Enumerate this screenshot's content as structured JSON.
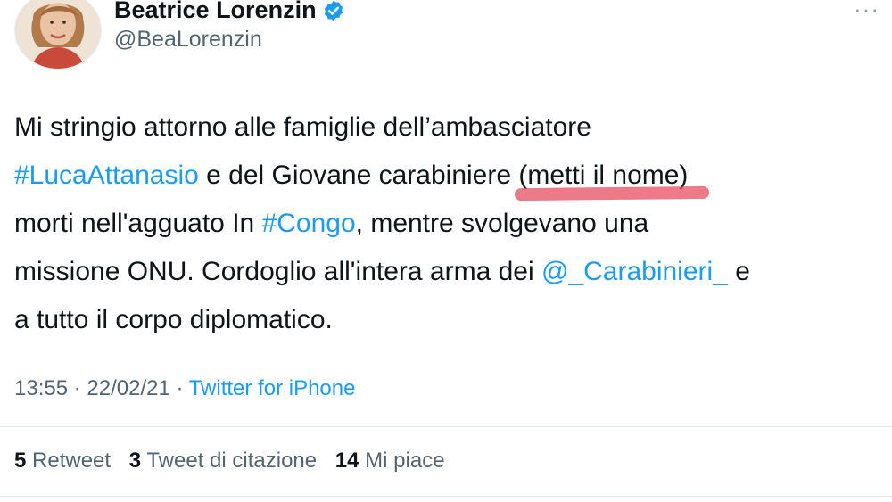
{
  "author": {
    "display_name": "Beatrice Lorenzin",
    "handle": "@BeaLorenzin",
    "verified": true
  },
  "more_menu": "···",
  "tweet": {
    "line1": "Mi stringio attorno alle famiglie dell’ambasciatore",
    "hashtag_luca": "#LucaAttanasio",
    "line2_mid": " e del Giovane carabiniere ",
    "placeholder_text": "(metti il nome)",
    "line3_start": "morti nell'agguato In ",
    "hashtag_congo": "#Congo",
    "line3_end": ", mentre svolgevano una",
    "line4_start": "missione ONU. Cordoglio all'intera arma dei ",
    "mention_carabinieri": "@_Carabinieri_",
    "line4_end": " e",
    "line5": "a tutto il corpo diplomatico."
  },
  "meta": {
    "time": "13:55",
    "sep1": " · ",
    "date": "22/02/21",
    "sep2": " · ",
    "source": "Twitter for iPhone"
  },
  "stats": {
    "retweets_count": "5",
    "retweets_label": "Retweet",
    "quotes_count": "3",
    "quotes_label": "Tweet di citazione",
    "likes_count": "14",
    "likes_label": "Mi piace"
  },
  "colors": {
    "link": "#1d9bf0",
    "secondary_text": "#536471",
    "primary_text": "#0f1419",
    "highlight": "#e6465a"
  }
}
